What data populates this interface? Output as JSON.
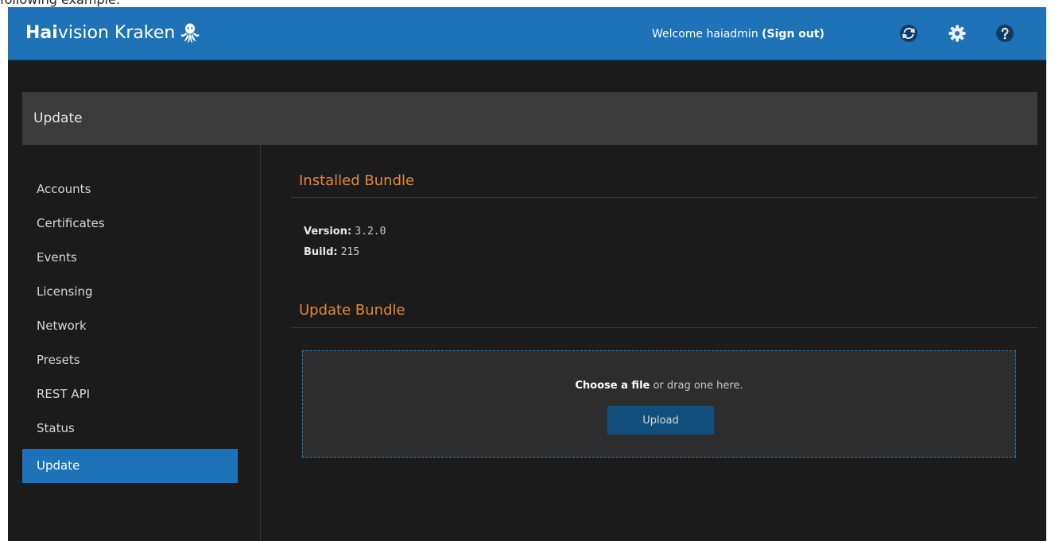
{
  "caption": "following example:",
  "header": {
    "brand_bold": "Hai",
    "brand_rest": "vision Kraken",
    "welcome_text": "Welcome haiadmin",
    "signout_label": "(Sign out)",
    "icons": [
      "sync-icon",
      "gear-icon",
      "help-icon"
    ]
  },
  "page": {
    "title": "Update"
  },
  "sidebar": {
    "items": [
      {
        "label": "Accounts"
      },
      {
        "label": "Certificates"
      },
      {
        "label": "Events"
      },
      {
        "label": "Licensing"
      },
      {
        "label": "Network"
      },
      {
        "label": "Presets"
      },
      {
        "label": "REST API"
      },
      {
        "label": "Status"
      },
      {
        "label": "Update",
        "active": true
      }
    ]
  },
  "installed": {
    "title": "Installed Bundle",
    "version_label": "Version:",
    "version_value": "3.2.0",
    "build_label": "Build:",
    "build_value": "215"
  },
  "update": {
    "title": "Update Bundle",
    "choose_label": "Choose a file",
    "drag_text": " or drag one here.",
    "upload_label": "Upload"
  },
  "colors": {
    "accent": "#1d72b8",
    "section_title": "#e08a3a",
    "background": "#1b1b1b"
  }
}
